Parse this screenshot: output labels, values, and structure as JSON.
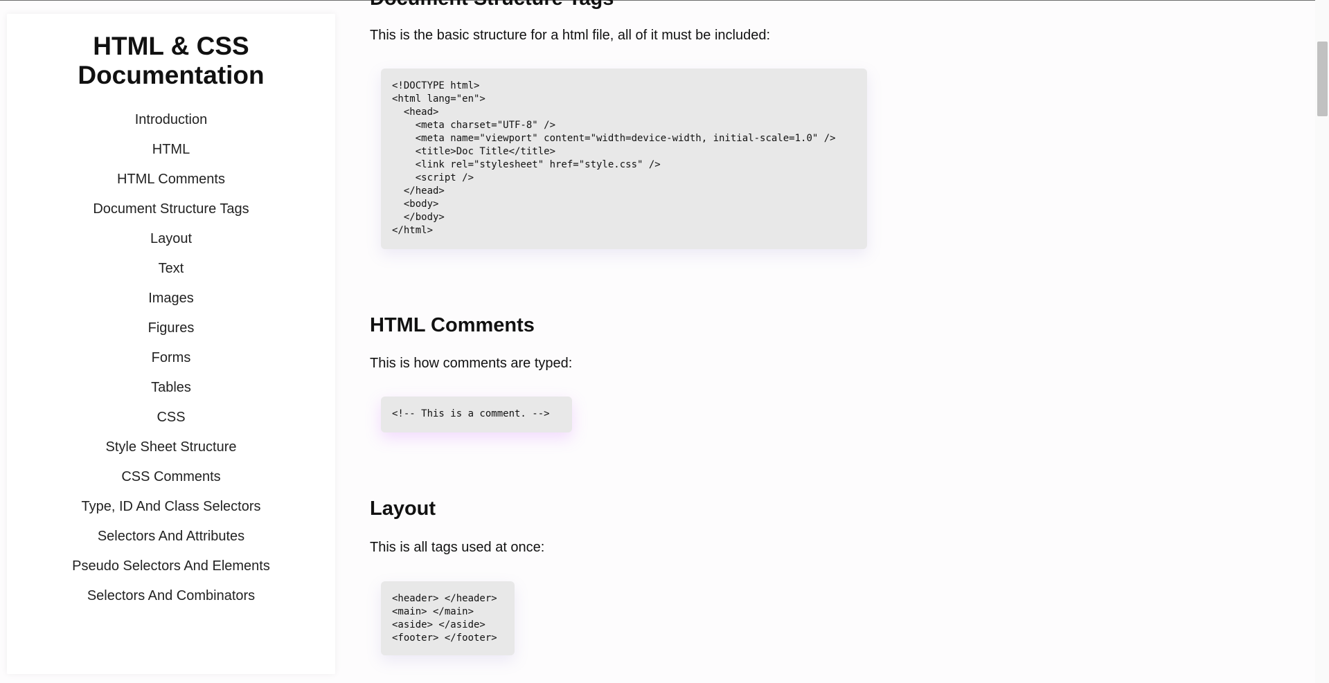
{
  "sidebar": {
    "title": "HTML & CSS Documentation",
    "nav_items": [
      "Introduction",
      "HTML",
      "HTML Comments",
      "Document Structure Tags",
      "Layout",
      "Text",
      "Images",
      "Figures",
      "Forms",
      "Tables",
      "CSS",
      "Style Sheet Structure",
      "CSS Comments",
      "Type, ID And Class Selectors",
      "Selectors And Attributes",
      "Pseudo Selectors And Elements",
      "Selectors And Combinators"
    ]
  },
  "main": {
    "sections": {
      "document_structure": {
        "title": "Document Structure Tags",
        "text": "This is the basic structure for a html file, all of it must be included:",
        "code": "<!DOCTYPE html>\n<html lang=\"en\">\n  <head>\n    <meta charset=\"UTF-8\" />\n    <meta name=\"viewport\" content=\"width=device-width, initial-scale=1.0\" />\n    <title>Doc Title</title>\n    <link rel=\"stylesheet\" href=\"style.css\" />\n    <script />\n  </head>\n  <body>\n  </body>\n</html>"
      },
      "html_comments": {
        "title": "HTML Comments",
        "text": "This is how comments are typed:",
        "code": "<!-- This is a comment. -->"
      },
      "layout": {
        "title": "Layout",
        "text": "This is all tags used at once:",
        "code": "<header> </header>\n<main> </main>\n<aside> </aside>\n<footer> </footer>"
      }
    }
  }
}
